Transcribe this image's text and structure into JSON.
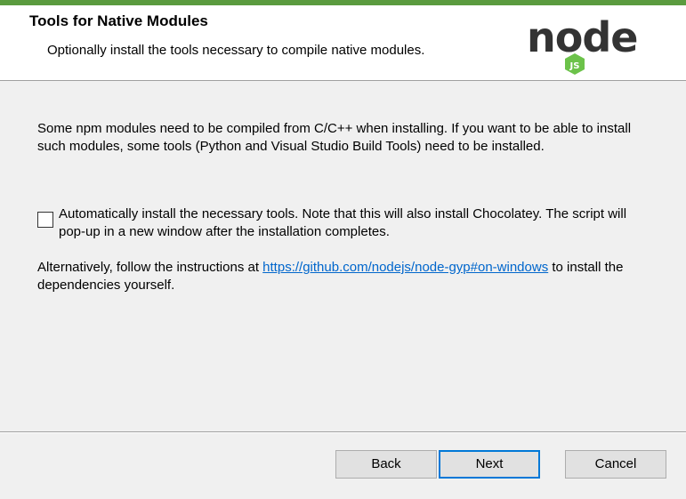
{
  "header": {
    "title": "Tools for Native Modules",
    "subtitle": "Optionally install the tools necessary to compile native modules."
  },
  "logo": {
    "text": "node",
    "badge": "JS",
    "icon": "nodejs-logo"
  },
  "main": {
    "intro": "Some npm modules need to be compiled from C/C++ when installing. If you want to be able to install such modules, some tools (Python and Visual Studio Build Tools) need to be installed.",
    "checkbox": {
      "checked": false,
      "label": "Automatically install the necessary tools. Note that this will also install Chocolatey. The script will pop-up in a new window after the installation completes."
    },
    "alternative": {
      "prefix": "Alternatively, follow the instructions at ",
      "link": "https://github.com/nodejs/node-gyp#on-windows",
      "suffix": " to install the dependencies yourself."
    }
  },
  "buttons": {
    "back": "Back",
    "next": "Next",
    "cancel": "Cancel"
  },
  "colors": {
    "accent_bar": "#5b9b3f",
    "logo_dark": "#333333",
    "logo_green": "#6cc24a",
    "link": "#0066cc",
    "focus": "#0078d7"
  }
}
